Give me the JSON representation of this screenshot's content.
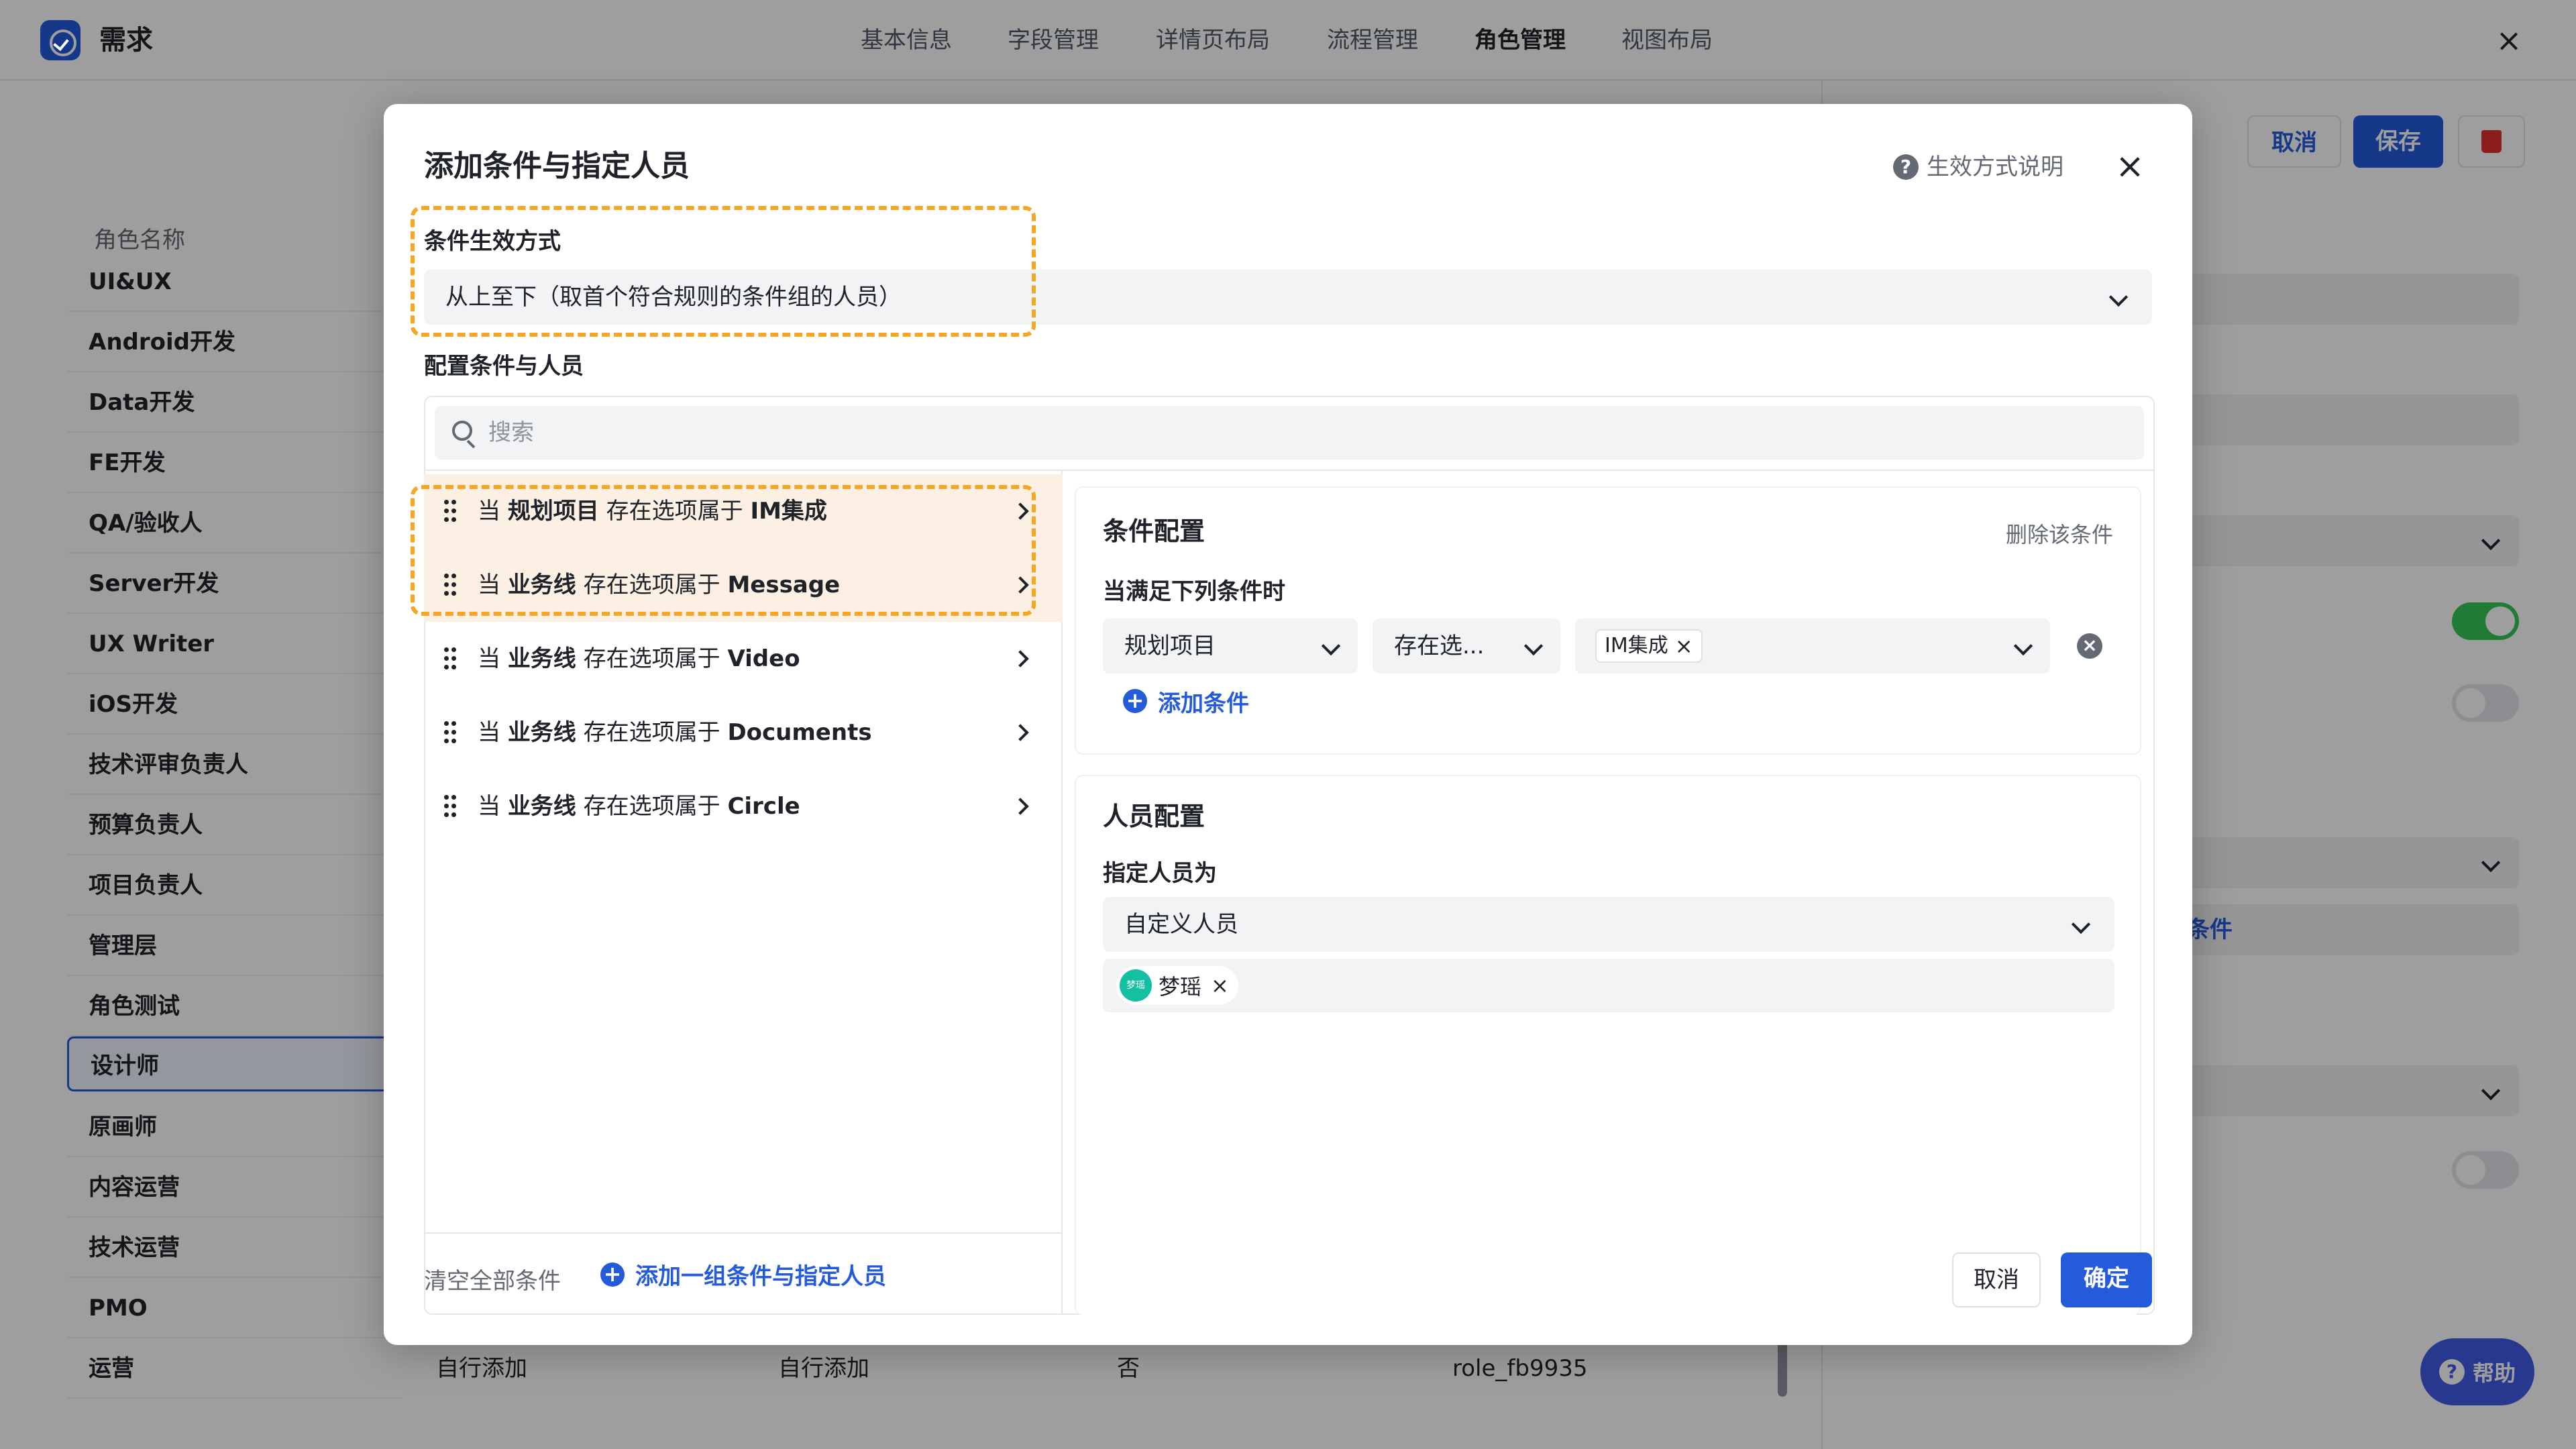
{
  "header": {
    "app_title": "需求",
    "tabs": [
      "基本信息",
      "字段管理",
      "详情页布局",
      "流程管理",
      "角色管理",
      "视图布局"
    ],
    "active_tab_index": 4,
    "close_icon": "close-icon"
  },
  "background": {
    "role_column_title": "角色名称",
    "roles": [
      "UI&UX",
      "Android开发",
      "Data开发",
      "FE开发",
      "QA/验收人",
      "Server开发",
      "UX Writer",
      "iOS开发",
      "技术评审负责人",
      "预算负责人",
      "项目负责人",
      "管理层",
      "角色测试",
      "设计师",
      "原画师",
      "内容运营",
      "技术运营",
      "PMO",
      "运营"
    ],
    "selected_role_index": 13,
    "last_row": {
      "col1": "自行添加",
      "col2": "自行添加",
      "col3": "否",
      "col4": "role_fb9935"
    },
    "right_pane": {
      "cancel": "取消",
      "save": "保存",
      "condition_link": "条件"
    },
    "help_button": "帮助",
    "colors": {
      "toggle_on": "#34c759",
      "accent": "#245bdb",
      "delete": "#e03030"
    }
  },
  "modal": {
    "title": "添加条件与指定人员",
    "help_link": "生效方式说明",
    "effect_label": "条件生效方式",
    "effect_value": "从上至下（取首个符合规则的条件组的人员）",
    "config_label": "配置条件与人员",
    "search_placeholder": "搜索",
    "conditions": [
      {
        "prefix": "当",
        "field": "规划项目",
        "op": "存在选项属于",
        "value": "IM集成"
      },
      {
        "prefix": "当",
        "field": "业务线",
        "op": "存在选项属于",
        "value": "Message"
      },
      {
        "prefix": "当",
        "field": "业务线",
        "op": "存在选项属于",
        "value": "Video"
      },
      {
        "prefix": "当",
        "field": "业务线",
        "op": "存在选项属于",
        "value": "Documents"
      },
      {
        "prefix": "当",
        "field": "业务线",
        "op": "存在选项属于",
        "value": "Circle"
      }
    ],
    "add_group": "添加一组条件与指定人员",
    "condition_panel": {
      "title": "条件配置",
      "delete": "删除该条件",
      "when_label": "当满足下列条件时",
      "field_select": "规划项目",
      "op_select": "存在选...",
      "value_tag": "IM集成",
      "add_condition": "添加条件"
    },
    "person_panel": {
      "title": "人员配置",
      "assign_label": "指定人员为",
      "type_select": "自定义人员",
      "person_avatar": "梦瑶",
      "person_name": "梦瑶"
    },
    "clear_all": "清空全部条件",
    "cancel": "取消",
    "confirm": "确定",
    "highlight_color": "#f5a623"
  }
}
